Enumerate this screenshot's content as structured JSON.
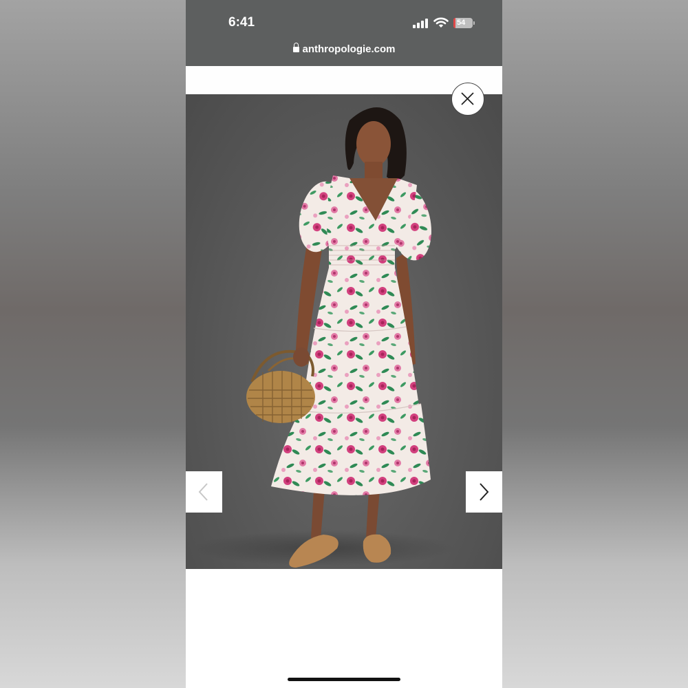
{
  "status_bar": {
    "time": "6:41",
    "battery_level": "54",
    "icons": [
      "signal-icon",
      "wifi-icon",
      "battery-icon"
    ]
  },
  "browser": {
    "url": "anthropologie.com",
    "lock_icon": "lock-icon"
  },
  "gallery": {
    "close_icon": "close-icon",
    "prev_icon": "chevron-left-icon",
    "next_icon": "chevron-right-icon"
  },
  "colors": {
    "status_bar_bg": "#5d5f5f",
    "photo_backdrop": "#5b5b5b",
    "dress_base": "#f4ece8",
    "floral_pink": "#d2407e",
    "floral_green": "#2f8a55"
  }
}
